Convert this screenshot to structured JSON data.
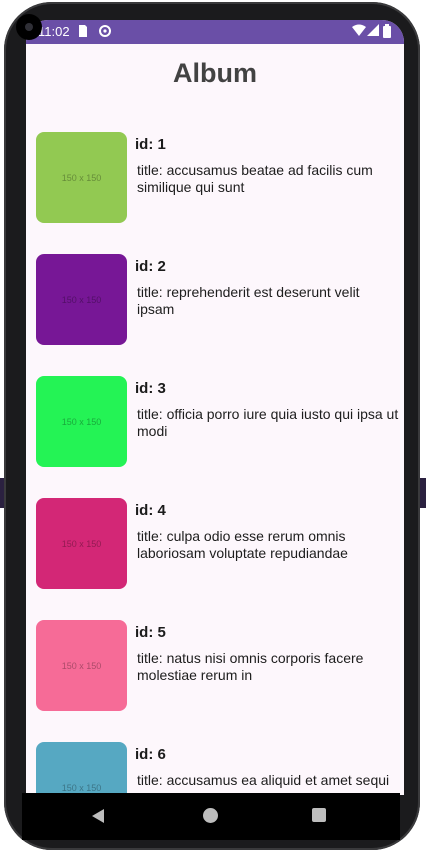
{
  "status_bar": {
    "time": "11:02",
    "icons": [
      "sim-card-icon",
      "data-saver-icon",
      "wifi-icon",
      "signal-icon",
      "battery-icon"
    ]
  },
  "album": {
    "title": "Album",
    "items": [
      {
        "id_label": "id: 1",
        "title": "title: accusamus beatae ad facilis cum similique qui sunt",
        "image_label": "150 x 150",
        "color": "#92c952"
      },
      {
        "id_label": "id: 2",
        "title": "title: reprehenderit est deserunt velit ipsam",
        "image_label": "150 x 150",
        "color": "#771796"
      },
      {
        "id_label": "id: 3",
        "title": "title: officia porro iure quia iusto qui ipsa ut modi",
        "image_label": "150 x 150",
        "color": "#24f355"
      },
      {
        "id_label": "id: 4",
        "title": "title: culpa odio esse rerum omnis laboriosam voluptate repudiandae",
        "image_label": "150 x 150",
        "color": "#d32776"
      },
      {
        "id_label": "id: 5",
        "title": "title: natus nisi omnis corporis facere molestiae rerum in",
        "image_label": "150 x 150",
        "color": "#f66b97"
      },
      {
        "id_label": "id: 6",
        "title": "title: accusamus ea aliquid et amet sequi nemo",
        "image_label": "150 x 150",
        "color": "#56a8c2"
      }
    ]
  },
  "nav_bar": {
    "icons": [
      "back-icon",
      "home-icon",
      "recent-apps-icon"
    ]
  }
}
